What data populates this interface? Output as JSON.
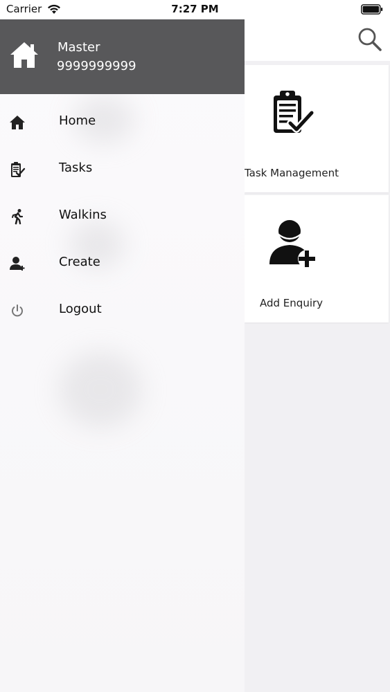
{
  "status_bar": {
    "carrier": "Carrier",
    "time": "7:27 PM",
    "icons": [
      "wifi-icon",
      "battery-icon"
    ]
  },
  "drawer": {
    "header": {
      "icon": "home-icon",
      "name": "Master",
      "phone": "9999999999",
      "background": "#58585a"
    },
    "items": [
      {
        "label": "Home",
        "icon": "home-icon"
      },
      {
        "label": "Tasks",
        "icon": "clipboard-check-icon"
      },
      {
        "label": "Walkins",
        "icon": "person-walking-icon"
      },
      {
        "label": "Create",
        "icon": "add-user-icon"
      },
      {
        "label": "Logout",
        "icon": "power-icon"
      }
    ]
  },
  "main": {
    "header": {
      "search_icon": "search-icon"
    },
    "cards": [
      {
        "label": "Task Management",
        "icon": "clipboard-check-icon"
      },
      {
        "label": "Add Enquiry",
        "icon": "add-user-icon"
      }
    ]
  }
}
